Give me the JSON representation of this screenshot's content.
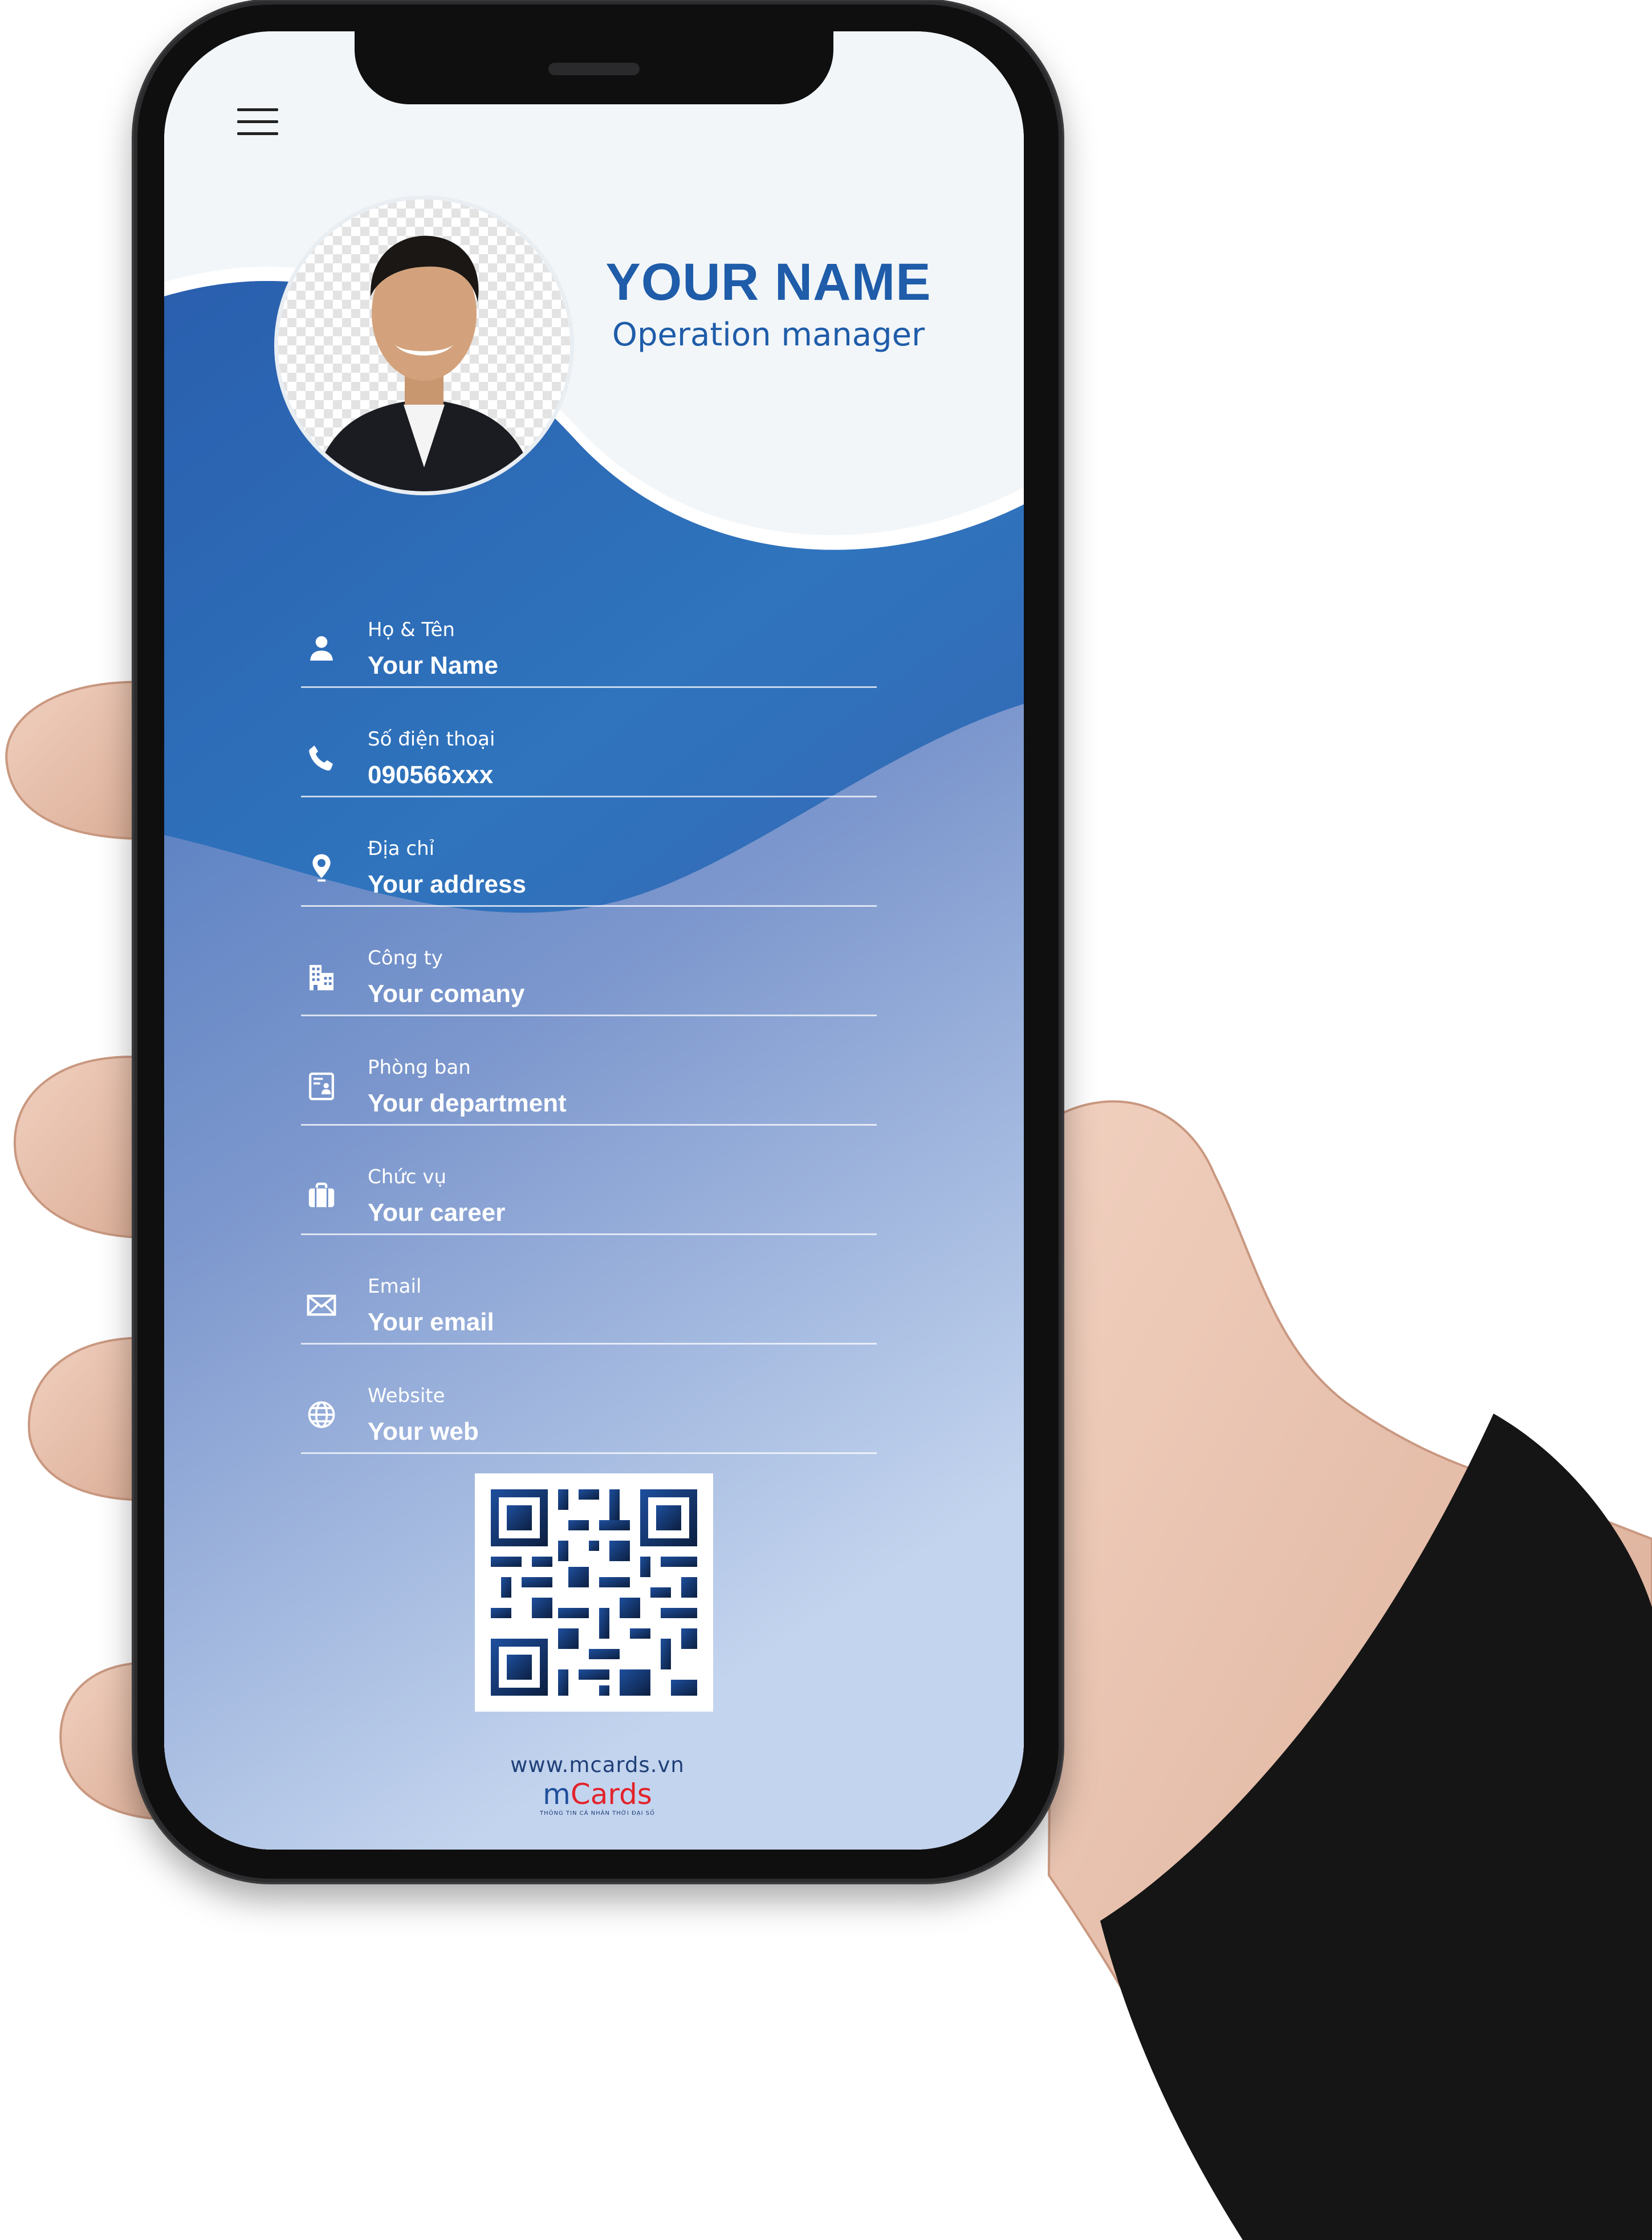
{
  "theme": {
    "accent": "#1f5ca9",
    "wave_dark": "#2a62b0",
    "wave_light": "#c3d4ee",
    "logo_red": "#e2232a"
  },
  "header": {
    "menu_icon": "hamburger-menu-icon"
  },
  "profile": {
    "name": "YOUR NAME",
    "title": "Operation manager"
  },
  "fields": [
    {
      "icon": "person-icon",
      "label": "Họ & Tên",
      "value": "Your Name"
    },
    {
      "icon": "phone-icon",
      "label": "Số điện thoại",
      "value": "090566xxx"
    },
    {
      "icon": "location-pin-icon",
      "label": "Địa chỉ",
      "value": "Your address"
    },
    {
      "icon": "building-icon",
      "label": "Công ty",
      "value": "Your comany"
    },
    {
      "icon": "id-badge-icon",
      "label": "Phòng ban",
      "value": "Your department"
    },
    {
      "icon": "briefcase-icon",
      "label": "Chức vụ",
      "value": "Your career"
    },
    {
      "icon": "envelope-icon",
      "label": "Email",
      "value": "Your email"
    },
    {
      "icon": "globe-icon",
      "label": "Website",
      "value": "Your web"
    }
  ],
  "footer": {
    "url": "www.mcards.vn",
    "logo_m": "m",
    "logo_cards": "Cards",
    "tagline": "THÔNG TIN CÁ NHÂN THỜI ĐẠI SỐ"
  }
}
